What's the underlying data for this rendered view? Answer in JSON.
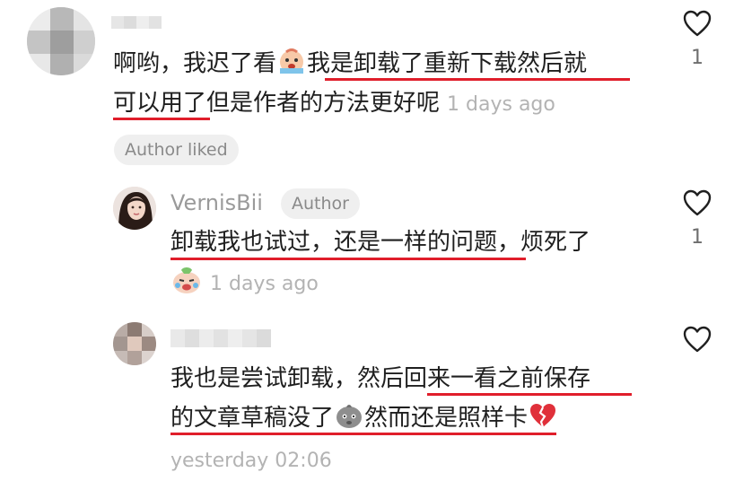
{
  "comments": [
    {
      "line1_plain": "啊哟，我迟了看",
      "line1_underlined": "我是卸载了重新下载然后就",
      "line2_underlined": "可以用了",
      "line2_plain": "但是作者的方法更好呢",
      "time": "1 days ago",
      "chip": "Author liked",
      "likes": "1"
    },
    {
      "username": "VernisBii",
      "badge": "Author",
      "text": "卸载我也试过，还是一样的问题，烦死了",
      "time": "1 days ago",
      "likes": "1"
    },
    {
      "line1_plain": "我也是尝试卸载，然后",
      "line1_underlined": "回来一看之前保存",
      "line2_underlined": "的文章草稿没了",
      "line2_underlined_b": "然而还是照样卡",
      "time": "yesterday 02:06",
      "likes": ""
    }
  ],
  "icons": {
    "heart": "heart-outline-icon",
    "emoji_cry_face": "crying-face-emoji-icon",
    "emoji_cry_dumpling": "crying-dumpling-emoji-icon",
    "emoji_grey_face": "grey-face-emoji-icon",
    "emoji_broken_heart": "broken-heart-emoji-icon"
  },
  "colors": {
    "underline": "#e01e2b",
    "meta_text": "#b3b3b3",
    "chip_bg": "#efefef"
  }
}
